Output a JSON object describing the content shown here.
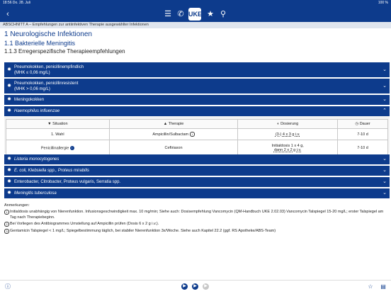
{
  "status": {
    "time": "18:56",
    "date": "Do. 28. Juli",
    "battery": "100 %"
  },
  "navbar": {
    "logo_text": "UKE"
  },
  "breadcrumb": "ABSCHNITT A – Empfehlungen zur antiinfektiven Therapie ausgewählter Infektionen",
  "headings": {
    "h1": "1 Neurologische Infektionen",
    "h2": "1.1 Bakterielle Meningitis",
    "h3": "1.1.3 Erregerspezifische Therapieempfehlungen"
  },
  "accordion": [
    {
      "line1": "Pneumokokken, penicillinempfindlich",
      "line2": "(MHK ≤ 0,06 mg/L)"
    },
    {
      "line1": "Pneumokokken, penicillinresistent",
      "line2": "(MHK > 0,06 mg/L)"
    },
    {
      "label": "Meningokokken"
    },
    {
      "label": "Haemophilus influenzae"
    },
    {
      "label": "Listeria monocytogenes"
    },
    {
      "label": "E. coli, Klebsiella spp., Proteus mirabilis"
    },
    {
      "label": "Enterobacter, Citrobacter, Proteus vulgaris, Serratia spp."
    },
    {
      "label": "Meningitis tuberculosa"
    }
  ],
  "table": {
    "headers": [
      "Situation",
      "Therapie",
      "Dosierung",
      "Dauer"
    ],
    "rows": [
      {
        "situation": "1. Wahl",
        "therapie": "Ampicillin/Sulbactam",
        "info": "i",
        "dose1": "(3-) 4 x 3 g i.v.",
        "dose2": "",
        "dauer": "7-10 d"
      },
      {
        "situation": "Penicillinallergie",
        "therapie": "Ceftriaxon",
        "info": "i",
        "dose1": "Initialdosis 1 x 4 g,",
        "dose2": "dann 2 x 2 g i.v.",
        "dauer": "7-10 d"
      }
    ]
  },
  "notes": {
    "title": "Anmerkungen:",
    "items": [
      {
        "num": "1",
        "text": "Initialdosis unabhängig von Nierenfunktion. Infusionsgeschwindigkeit max. 10 mg/min; Siehe auch: Dosisempfehlung Vancomycin (QM-Handbuch UKE 2.02.03) Vancomycin Talspiegel 15-20 mg/L; erster Talspiegel am Tag nach Therapiebeginn."
      },
      {
        "num": "2",
        "text": "Bei Vorliegen des Antibiogrammes Umstellung auf Ampicillin prüfen (Dosis 6 x 2 g i.v.)."
      },
      {
        "num": "3",
        "text": "Gentamicin Talspiegel < 1 mg/L; Spiegelbestimmung täglich, bei stabiler Nierenfunktion 3x/Woche. Siehe auch Kapitel 22.2 (ggf. RS Apotheke/ABS-Team)"
      }
    ]
  },
  "colors": {
    "brand": "#0d3b8c",
    "breadcrumb_bg": "#dfe5ee"
  },
  "icons": [
    "back-chevron-icon",
    "list-icon",
    "phone-icon",
    "book-icon",
    "star-icon",
    "search-icon",
    "info-icon",
    "play-icon",
    "star-outline-icon",
    "pdf-icon"
  ]
}
